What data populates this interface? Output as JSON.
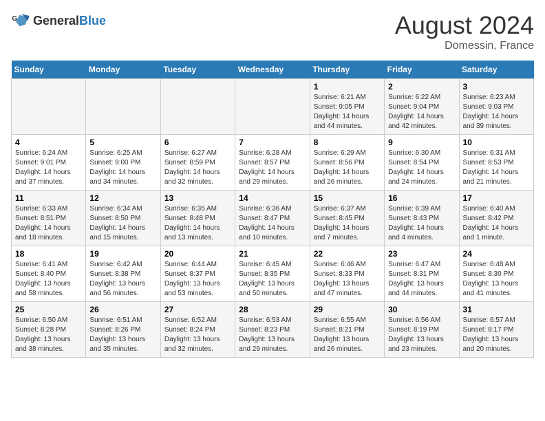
{
  "header": {
    "logo_general": "General",
    "logo_blue": "Blue",
    "main_title": "August 2024",
    "subtitle": "Domessin, France"
  },
  "calendar": {
    "days_of_week": [
      "Sunday",
      "Monday",
      "Tuesday",
      "Wednesday",
      "Thursday",
      "Friday",
      "Saturday"
    ],
    "weeks": [
      [
        {
          "day": "",
          "detail": ""
        },
        {
          "day": "",
          "detail": ""
        },
        {
          "day": "",
          "detail": ""
        },
        {
          "day": "",
          "detail": ""
        },
        {
          "day": "1",
          "detail": "Sunrise: 6:21 AM\nSunset: 9:05 PM\nDaylight: 14 hours\nand 44 minutes."
        },
        {
          "day": "2",
          "detail": "Sunrise: 6:22 AM\nSunset: 9:04 PM\nDaylight: 14 hours\nand 42 minutes."
        },
        {
          "day": "3",
          "detail": "Sunrise: 6:23 AM\nSunset: 9:03 PM\nDaylight: 14 hours\nand 39 minutes."
        }
      ],
      [
        {
          "day": "4",
          "detail": "Sunrise: 6:24 AM\nSunset: 9:01 PM\nDaylight: 14 hours\nand 37 minutes."
        },
        {
          "day": "5",
          "detail": "Sunrise: 6:25 AM\nSunset: 9:00 PM\nDaylight: 14 hours\nand 34 minutes."
        },
        {
          "day": "6",
          "detail": "Sunrise: 6:27 AM\nSunset: 8:59 PM\nDaylight: 14 hours\nand 32 minutes."
        },
        {
          "day": "7",
          "detail": "Sunrise: 6:28 AM\nSunset: 8:57 PM\nDaylight: 14 hours\nand 29 minutes."
        },
        {
          "day": "8",
          "detail": "Sunrise: 6:29 AM\nSunset: 8:56 PM\nDaylight: 14 hours\nand 26 minutes."
        },
        {
          "day": "9",
          "detail": "Sunrise: 6:30 AM\nSunset: 8:54 PM\nDaylight: 14 hours\nand 24 minutes."
        },
        {
          "day": "10",
          "detail": "Sunrise: 6:31 AM\nSunset: 8:53 PM\nDaylight: 14 hours\nand 21 minutes."
        }
      ],
      [
        {
          "day": "11",
          "detail": "Sunrise: 6:33 AM\nSunset: 8:51 PM\nDaylight: 14 hours\nand 18 minutes."
        },
        {
          "day": "12",
          "detail": "Sunrise: 6:34 AM\nSunset: 8:50 PM\nDaylight: 14 hours\nand 15 minutes."
        },
        {
          "day": "13",
          "detail": "Sunrise: 6:35 AM\nSunset: 8:48 PM\nDaylight: 14 hours\nand 13 minutes."
        },
        {
          "day": "14",
          "detail": "Sunrise: 6:36 AM\nSunset: 8:47 PM\nDaylight: 14 hours\nand 10 minutes."
        },
        {
          "day": "15",
          "detail": "Sunrise: 6:37 AM\nSunset: 8:45 PM\nDaylight: 14 hours\nand 7 minutes."
        },
        {
          "day": "16",
          "detail": "Sunrise: 6:39 AM\nSunset: 8:43 PM\nDaylight: 14 hours\nand 4 minutes."
        },
        {
          "day": "17",
          "detail": "Sunrise: 6:40 AM\nSunset: 8:42 PM\nDaylight: 14 hours\nand 1 minute."
        }
      ],
      [
        {
          "day": "18",
          "detail": "Sunrise: 6:41 AM\nSunset: 8:40 PM\nDaylight: 13 hours\nand 58 minutes."
        },
        {
          "day": "19",
          "detail": "Sunrise: 6:42 AM\nSunset: 8:38 PM\nDaylight: 13 hours\nand 56 minutes."
        },
        {
          "day": "20",
          "detail": "Sunrise: 6:44 AM\nSunset: 8:37 PM\nDaylight: 13 hours\nand 53 minutes."
        },
        {
          "day": "21",
          "detail": "Sunrise: 6:45 AM\nSunset: 8:35 PM\nDaylight: 13 hours\nand 50 minutes."
        },
        {
          "day": "22",
          "detail": "Sunrise: 6:46 AM\nSunset: 8:33 PM\nDaylight: 13 hours\nand 47 minutes."
        },
        {
          "day": "23",
          "detail": "Sunrise: 6:47 AM\nSunset: 8:31 PM\nDaylight: 13 hours\nand 44 minutes."
        },
        {
          "day": "24",
          "detail": "Sunrise: 6:48 AM\nSunset: 8:30 PM\nDaylight: 13 hours\nand 41 minutes."
        }
      ],
      [
        {
          "day": "25",
          "detail": "Sunrise: 6:50 AM\nSunset: 8:28 PM\nDaylight: 13 hours\nand 38 minutes."
        },
        {
          "day": "26",
          "detail": "Sunrise: 6:51 AM\nSunset: 8:26 PM\nDaylight: 13 hours\nand 35 minutes."
        },
        {
          "day": "27",
          "detail": "Sunrise: 6:52 AM\nSunset: 8:24 PM\nDaylight: 13 hours\nand 32 minutes."
        },
        {
          "day": "28",
          "detail": "Sunrise: 6:53 AM\nSunset: 8:23 PM\nDaylight: 13 hours\nand 29 minutes."
        },
        {
          "day": "29",
          "detail": "Sunrise: 6:55 AM\nSunset: 8:21 PM\nDaylight: 13 hours\nand 26 minutes."
        },
        {
          "day": "30",
          "detail": "Sunrise: 6:56 AM\nSunset: 8:19 PM\nDaylight: 13 hours\nand 23 minutes."
        },
        {
          "day": "31",
          "detail": "Sunrise: 6:57 AM\nSunset: 8:17 PM\nDaylight: 13 hours\nand 20 minutes."
        }
      ]
    ]
  }
}
